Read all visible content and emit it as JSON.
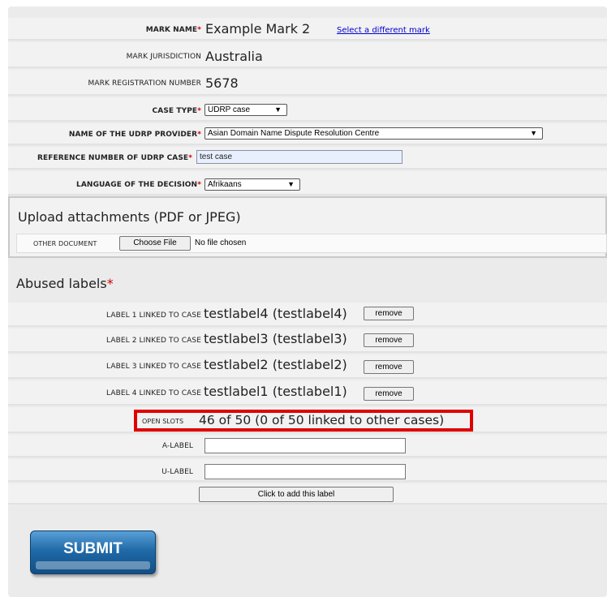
{
  "form": {
    "mark_name": {
      "label": "MARK NAME",
      "value": "Example Mark 2",
      "link": "Select a different mark"
    },
    "mark_jurisdiction": {
      "label": "MARK JURISDICTION",
      "value": "Australia"
    },
    "mark_registration_number": {
      "label": "MARK REGISTRATION NUMBER",
      "value": "5678"
    },
    "case_type": {
      "label": "CASE TYPE",
      "selected": "UDRP case"
    },
    "udrp_provider": {
      "label": "NAME OF THE UDRP PROVIDER",
      "selected": "Asian Domain Name Dispute Resolution Centre"
    },
    "udrp_reference": {
      "label": "REFERENCE NUMBER OF UDRP CASE",
      "value": "test case"
    },
    "decision_language": {
      "label": "LANGUAGE OF THE DECISION",
      "selected": "Afrikaans"
    },
    "required_mark": "*"
  },
  "upload": {
    "title": "Upload attachments (PDF or JPEG)",
    "other_document_label": "OTHER DOCUMENT",
    "choose_file": "Choose File",
    "no_file": "No file chosen"
  },
  "abused_labels": {
    "title": "Abused labels",
    "labels": [
      {
        "label": "LABEL 1 LINKED TO CASE",
        "value": "testlabel4 (testlabel4)",
        "remove": "remove"
      },
      {
        "label": "LABEL 2 LINKED TO CASE",
        "value": "testlabel3 (testlabel3)",
        "remove": "remove"
      },
      {
        "label": "LABEL 3 LINKED TO CASE",
        "value": "testlabel2 (testlabel2)",
        "remove": "remove"
      },
      {
        "label": "LABEL 4 LINKED TO CASE",
        "value": "testlabel1 (testlabel1)",
        "remove": "remove"
      }
    ],
    "open_slots_label": "OPEN SLOTS",
    "open_slots_value": "46 of 50 (0 of 50 linked to other cases)",
    "a_label": "A-LABEL",
    "u_label": "U-LABEL",
    "add_button": "Click to add this label"
  },
  "submit": "SUBMIT",
  "colors": {
    "required": "#cc0000",
    "highlight_border": "#e00000",
    "link": "#0000cc",
    "submit": "#1f6aa8"
  }
}
